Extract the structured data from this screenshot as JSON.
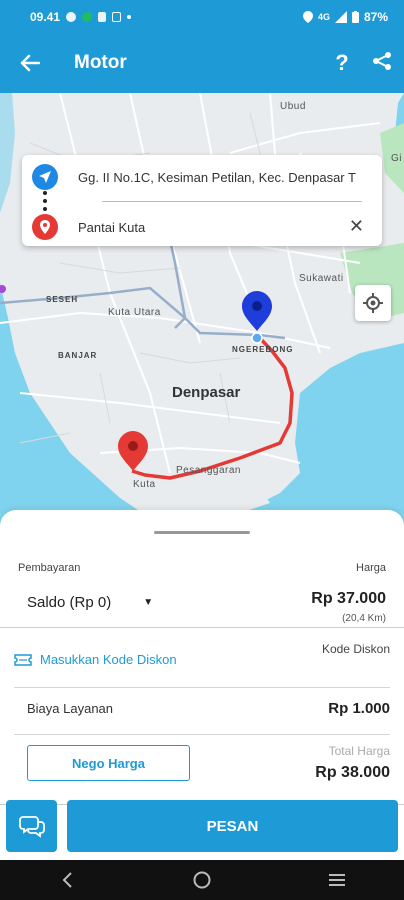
{
  "status_bar": {
    "time": "09.41",
    "signal_text": "4G",
    "battery": "87%"
  },
  "app_bar": {
    "title": "Motor",
    "help_label": "?"
  },
  "map": {
    "labels": {
      "ubud": "Ubud",
      "sukawati": "Sukawati",
      "seseh": "SESEH",
      "kuta_utara": "Kuta Utara",
      "banjar": "BANJAR",
      "ngerebong": "NGEREBONG",
      "denpasar": "Denpasar",
      "pesanggaran": "Pesanggaran",
      "kuta": "Kuta",
      "gi": "Gi"
    }
  },
  "address": {
    "pickup": "Gg. II No.1C, Kesiman Petilan, Kec. Denpasar T",
    "destination": "Pantai Kuta",
    "close_label": "✕"
  },
  "sheet": {
    "payment_label": "Pembayaran",
    "price_label": "Harga",
    "payment_method": "Saldo (Rp 0)",
    "price": "Rp 37.000",
    "distance": "(20,4 Km)",
    "discount_code_label": "Kode Diskon",
    "discount_link": "Masukkan Kode Diskon",
    "service_fee_label": "Biaya Layanan",
    "service_fee": "Rp 1.000",
    "nego_button": "Nego Harga",
    "total_label": "Total Harga",
    "total": "Rp 38.000",
    "order_button": "PESAN"
  },
  "colors": {
    "primary": "#1e9ad6",
    "route": "#e53935",
    "pickup_marker": "#1e3ddb",
    "dest_marker": "#e53935",
    "sea": "#7fd3ee"
  }
}
